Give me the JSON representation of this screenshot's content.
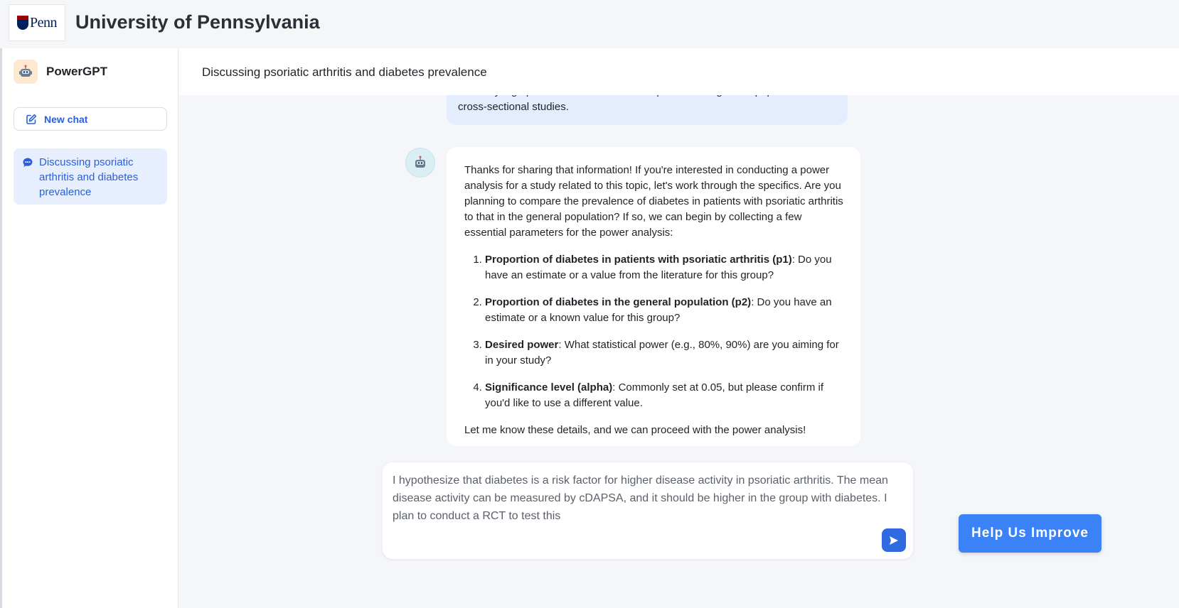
{
  "header": {
    "logo_text": "Penn",
    "title": "University of Pennsylvania"
  },
  "sidebar": {
    "app_name": "PowerGPT",
    "new_chat_label": "New chat",
    "conversations": [
      {
        "label": "Discussing psoriatic arthritis and diabetes prevalence",
        "active": true
      }
    ]
  },
  "chat": {
    "title": "Discussing psoriatic arthritis and diabetes prevalence",
    "user_message_visible": "relatively high prevalence of diabetes compared to the general population in cross-sectional studies.",
    "assistant": {
      "intro": "Thanks for sharing that information! If you're interested in conducting a power analysis for a study related to this topic, let's work through the specifics. Are you planning to compare the prevalence of diabetes in patients with psoriatic arthritis to that in the general population? If so, we can begin by collecting a few essential parameters for the power analysis:",
      "items": [
        {
          "bold": "Proportion of diabetes in patients with psoriatic arthritis (p1)",
          "text": ": Do you have an estimate or a value from the literature for this group?"
        },
        {
          "bold": "Proportion of diabetes in the general population (p2)",
          "text": ": Do you have an estimate or a known value for this group?"
        },
        {
          "bold": "Desired power",
          "text": ": What statistical power (e.g., 80%, 90%) are you aiming for in your study?"
        },
        {
          "bold": "Significance level (alpha)",
          "text": ": Commonly set at 0.05, but please confirm if you'd like to use a different value."
        }
      ],
      "outro": "Let me know these details, and we can proceed with the power analysis!"
    }
  },
  "composer": {
    "value": "I hypothesize that diabetes is a risk factor for higher disease activity in psoriatic arthritis. The mean disease activity can be measured by cDAPSA, and it should be higher in the group with diabetes. I plan to conduct a RCT to test this"
  },
  "help_button_label": "Help Us Improve",
  "colors": {
    "accent": "#2f6ae0",
    "help_button": "#3b82f6",
    "user_bubble": "#e4edfd",
    "active_conv": "#e7efff",
    "penn_navy": "#011f5b",
    "penn_red": "#990000"
  }
}
